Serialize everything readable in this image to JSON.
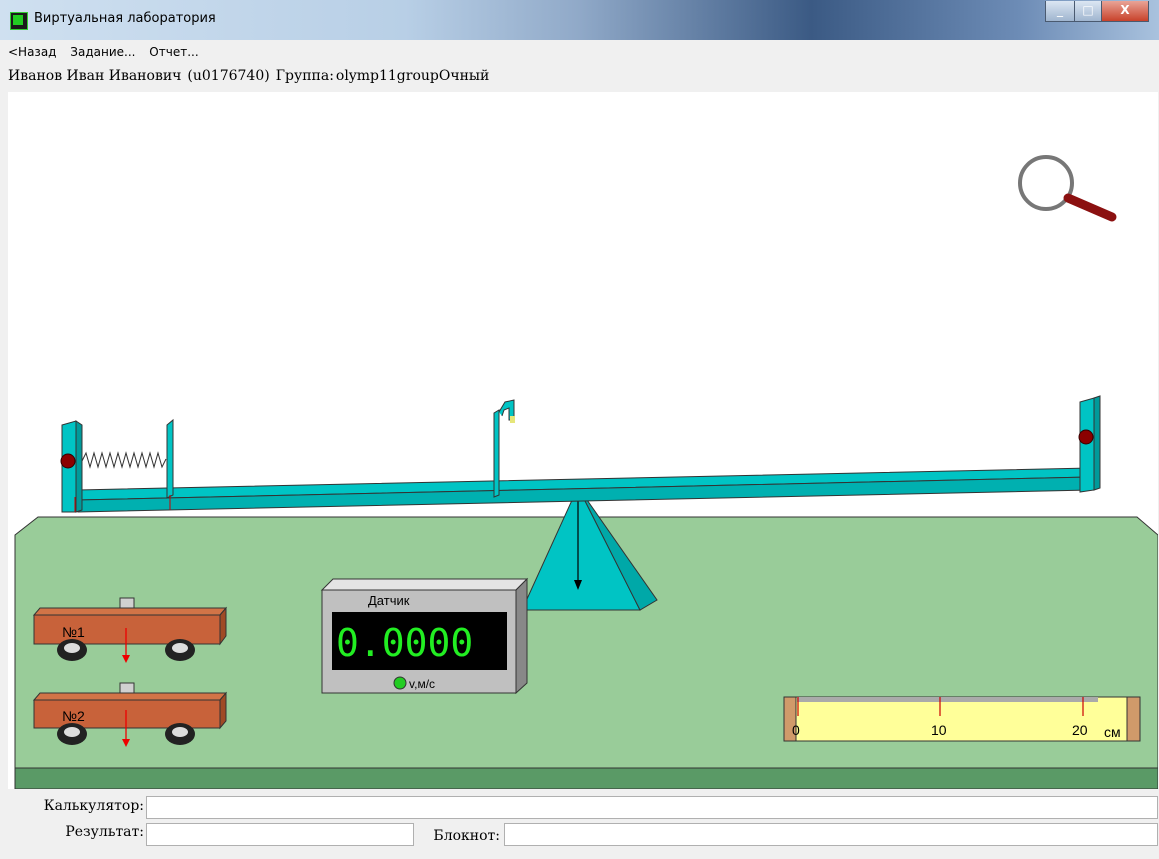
{
  "window": {
    "title": "Виртуальная лаборатория",
    "close_glyph": "X"
  },
  "menu": {
    "items": [
      "<Назад",
      "Задание...",
      "Отчет..."
    ]
  },
  "user": {
    "name": "Иванов Иван Иванович",
    "id": "(u0176740)",
    "group_label": "Группа:",
    "group": "olymp11groupОчный"
  },
  "lab": {
    "carts": [
      {
        "label": "№1"
      },
      {
        "label": "№2"
      }
    ],
    "sensor": {
      "title": "Датчик",
      "value": "0.0000",
      "unit": "v,м/с",
      "indicator_color": "#22cc22",
      "display_color": "#22ee22"
    },
    "ruler": {
      "ticks": [
        "0",
        "10",
        "20"
      ],
      "unit": "см"
    },
    "colors": {
      "beam": "#00c4c4",
      "table": "#99cc99",
      "cart": "#c8623a",
      "ball": "#8b0000"
    }
  },
  "form": {
    "calculator_label": "Калькулятор:",
    "result_label": "Результат:",
    "notepad_label": "Блокнот:"
  }
}
